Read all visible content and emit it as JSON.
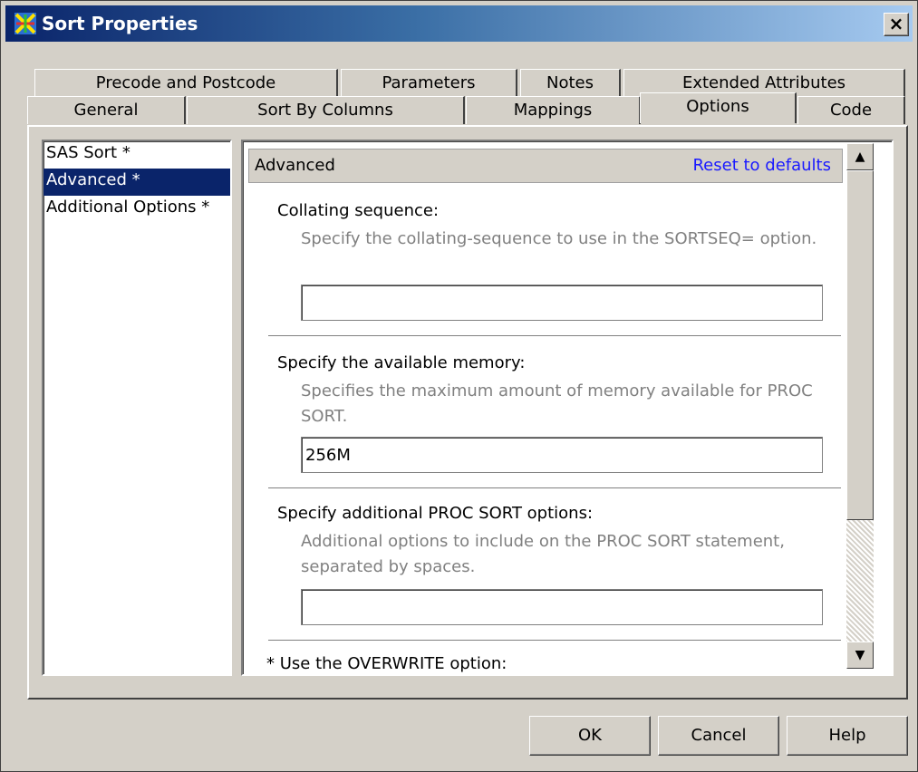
{
  "window": {
    "title": "Sort Properties",
    "close_label": "×"
  },
  "tabs_row1": [
    "Precode and Postcode",
    "Parameters",
    "Notes",
    "Extended Attributes"
  ],
  "tabs_row2": [
    "General",
    "Sort By Columns",
    "Mappings",
    "Options",
    "Code"
  ],
  "active_tab": "Options",
  "sidebar": {
    "items": [
      {
        "label": "SAS Sort *",
        "selected": false
      },
      {
        "label": "Advanced *",
        "selected": true
      },
      {
        "label": "Additional Options *",
        "selected": false
      }
    ]
  },
  "content": {
    "header_title": "Advanced",
    "reset_link": "Reset to defaults",
    "sections": [
      {
        "label": "Collating sequence:",
        "description": "Specify the collating-sequence to use in the SORTSEQ= option.",
        "value": ""
      },
      {
        "label": "Specify the available memory:",
        "description": "Specifies the maximum amount of memory available for PROC SORT.",
        "value": "256M"
      },
      {
        "label": "Specify additional PROC SORT options:",
        "description": "Additional options to include on the PROC SORT statement, separated by spaces.",
        "value": ""
      }
    ],
    "next_option_label": "* Use the OVERWRITE option:"
  },
  "buttons": {
    "ok": "OK",
    "cancel": "Cancel",
    "help": "Help"
  }
}
